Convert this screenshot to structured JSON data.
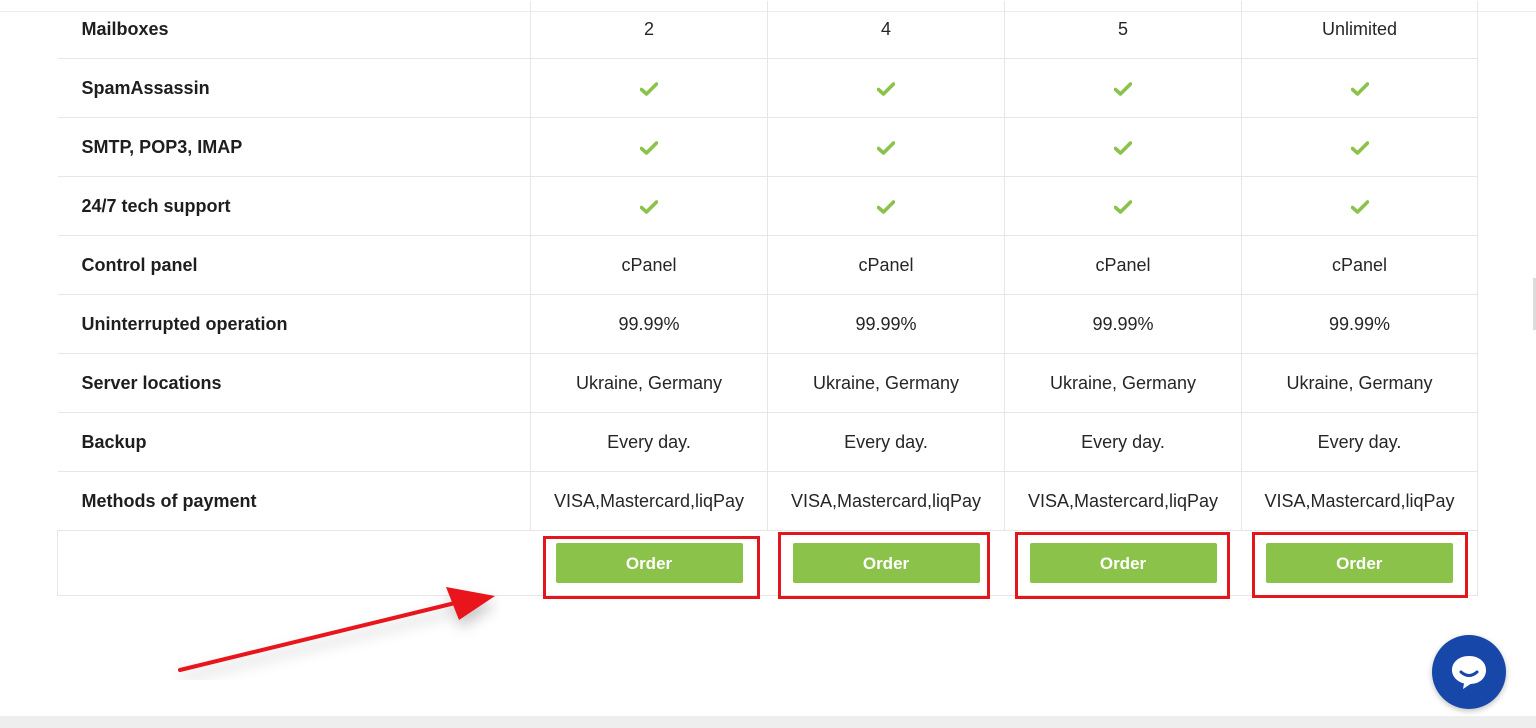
{
  "columns": 4,
  "rows": [
    {
      "feature": "Mailboxes",
      "values": [
        "2",
        "4",
        "5",
        "Unlimited"
      ]
    },
    {
      "feature": "SpamAssassin",
      "check": true
    },
    {
      "feature": "SMTP, POP3, IMAP",
      "check": true
    },
    {
      "feature": "24/7 tech support",
      "check": true
    },
    {
      "feature": "Control panel",
      "values": [
        "cPanel",
        "cPanel",
        "cPanel",
        "cPanel"
      ]
    },
    {
      "feature": "Uninterrupted operation",
      "values": [
        "99.99%",
        "99.99%",
        "99.99%",
        "99.99%"
      ]
    },
    {
      "feature": "Server locations",
      "values": [
        "Ukraine, Germany",
        "Ukraine, Germany",
        "Ukraine, Germany",
        "Ukraine, Germany"
      ]
    },
    {
      "feature": "Backup",
      "values": [
        "Every day.",
        "Every day.",
        "Every day.",
        "Every day."
      ]
    },
    {
      "feature": "Methods of payment",
      "values": [
        "VISA,Mastercard,liqPay",
        "VISA,Mastercard,liqPay",
        "VISA,Mastercard,liqPay",
        "VISA,Mastercard,liqPay"
      ]
    }
  ],
  "order_label": "Order",
  "colors": {
    "check": "#8bc34a",
    "button": "#8bc34a",
    "highlight": "#e3151d",
    "arrow": "#e8141c",
    "chat": "#1747a8"
  },
  "icons": {
    "check": "check-icon",
    "chat": "chat-bubble-icon",
    "arrow": "arrow-annotation"
  }
}
